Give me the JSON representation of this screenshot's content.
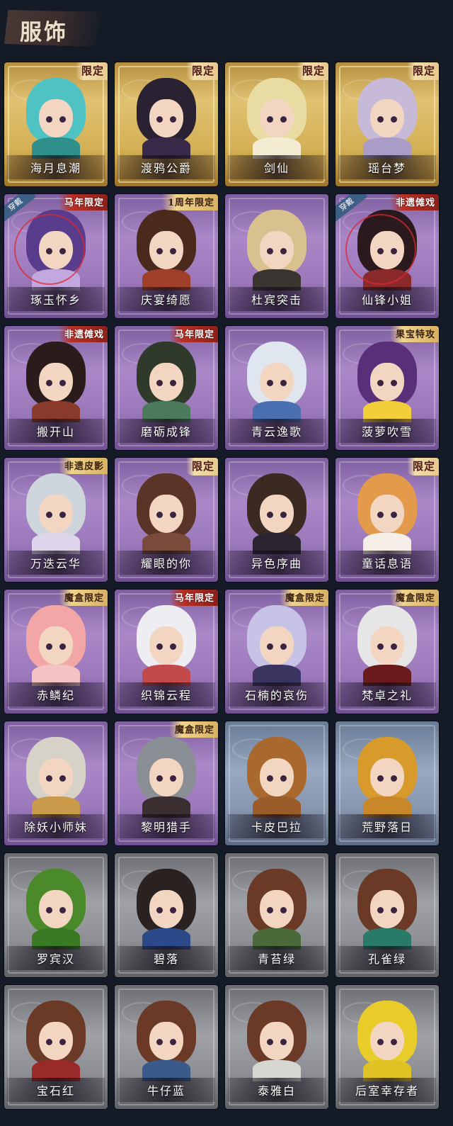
{
  "header": {
    "title": "服饰"
  },
  "outfits": [
    {
      "name": "海月息潮",
      "tag": "限定",
      "tag_style": "light",
      "rarity": "gold",
      "worn": false,
      "hair": "#4fc2c4",
      "body": "#2f8f8a"
    },
    {
      "name": "渡鸦公爵",
      "tag": "限定",
      "tag_style": "light",
      "rarity": "gold",
      "worn": false,
      "hair": "#2a2233",
      "body": "#3a2a4a"
    },
    {
      "name": "剑仙",
      "tag": "限定",
      "tag_style": "light",
      "rarity": "gold",
      "worn": false,
      "hair": "#e8dca2",
      "body": "#f4ecd2"
    },
    {
      "name": "瑶台梦",
      "tag": "限定",
      "tag_style": "light",
      "rarity": "gold",
      "worn": false,
      "hair": "#c7b9d8",
      "body": "#a99cc7"
    },
    {
      "name": "琢玉怀乡",
      "tag": "马年限定",
      "tag_style": "red",
      "rarity": "purple",
      "worn": true,
      "worn_label": "穿戴",
      "hair": "#5a3c8c",
      "body": "#c3a8e0"
    },
    {
      "name": "庆宴绮愿",
      "tag": "1周年限定",
      "tag_style": "dark",
      "rarity": "purple",
      "worn": false,
      "hair": "#4a2a1c",
      "body": "#a0402a"
    },
    {
      "name": "杜宾突击",
      "tag": "",
      "tag_style": "light",
      "rarity": "purple",
      "worn": false,
      "hair": "#d8c18e",
      "body": "#3a3530"
    },
    {
      "name": "仙锋小姐",
      "tag": "非遗傩戏",
      "tag_style": "red",
      "rarity": "purple",
      "worn": true,
      "worn_label": "穿戴",
      "hair": "#2a1a1e",
      "body": "#8a2a2a"
    },
    {
      "name": "搬开山",
      "tag": "非遗傩戏",
      "tag_style": "red",
      "rarity": "purple",
      "worn": false,
      "hair": "#2a1c1a",
      "body": "#8a3a2a"
    },
    {
      "name": "磨砺成锋",
      "tag": "马年限定",
      "tag_style": "red",
      "rarity": "purple",
      "worn": false,
      "hair": "#2f3a2a",
      "body": "#4a7a5a"
    },
    {
      "name": "青云逸歌",
      "tag": "",
      "tag_style": "light",
      "rarity": "purple",
      "worn": false,
      "hair": "#dfe6f0",
      "body": "#4a6fb0"
    },
    {
      "name": "菠萝吹雪",
      "tag": "果宝特攻",
      "tag_style": "dark",
      "rarity": "purple",
      "worn": false,
      "hair": "#5a2f7a",
      "body": "#f2cf3a"
    },
    {
      "name": "万迭云华",
      "tag": "非遗皮影",
      "tag_style": "dark",
      "rarity": "purple",
      "worn": false,
      "hair": "#cfd5dc",
      "body": "#ddd6ea"
    },
    {
      "name": "耀眼的你",
      "tag": "限定",
      "tag_style": "light",
      "rarity": "purple",
      "worn": false,
      "hair": "#5a3426",
      "body": "#7a4a3a"
    },
    {
      "name": "异色序曲",
      "tag": "",
      "tag_style": "light",
      "rarity": "purple",
      "worn": false,
      "hair": "#3a2a22",
      "body": "#2a2530"
    },
    {
      "name": "童话息语",
      "tag": "限定",
      "tag_style": "light",
      "rarity": "purple",
      "worn": false,
      "hair": "#e39a4a",
      "body": "#f4eee6"
    },
    {
      "name": "赤鳞纪",
      "tag": "魔盒限定",
      "tag_style": "dark",
      "rarity": "purple",
      "worn": false,
      "hair": "#f2a6a6",
      "body": "#f4c2c2"
    },
    {
      "name": "织锦云程",
      "tag": "马年限定",
      "tag_style": "red",
      "rarity": "purple",
      "worn": false,
      "hair": "#eeeef2",
      "body": "#c24a4a"
    },
    {
      "name": "石楠的哀伤",
      "tag": "魔盒限定",
      "tag_style": "dark",
      "rarity": "purple",
      "worn": false,
      "hair": "#c6c3e6",
      "body": "#3a3560"
    },
    {
      "name": "梵卓之礼",
      "tag": "魔盒限定",
      "tag_style": "dark",
      "rarity": "purple",
      "worn": false,
      "hair": "#e6e6e6",
      "body": "#6a1a1a"
    },
    {
      "name": "除妖小师妹",
      "tag": "",
      "tag_style": "light",
      "rarity": "purple",
      "worn": false,
      "hair": "#d6d2c8",
      "body": "#c99a4a"
    },
    {
      "name": "黎明猎手",
      "tag": "魔盒限定",
      "tag_style": "dark",
      "rarity": "purple",
      "worn": false,
      "hair": "#8a8f96",
      "body": "#3a2e30"
    },
    {
      "name": "卡皮巴拉",
      "tag": "",
      "tag_style": "light",
      "rarity": "blue",
      "worn": false,
      "hair": "#a8682e",
      "body": "#9a5c28"
    },
    {
      "name": "荒野落日",
      "tag": "",
      "tag_style": "light",
      "rarity": "blue",
      "worn": false,
      "hair": "#d89a2a",
      "body": "#c8882a"
    },
    {
      "name": "罗宾汉",
      "tag": "",
      "tag_style": "light",
      "rarity": "gray",
      "worn": false,
      "hair": "#4a8a2a",
      "body": "#3a7a24"
    },
    {
      "name": "碧落",
      "tag": "",
      "tag_style": "light",
      "rarity": "gray",
      "worn": false,
      "hair": "#2a2220",
      "body": "#2c4a8a"
    },
    {
      "name": "青苔绿",
      "tag": "",
      "tag_style": "light",
      "rarity": "gray",
      "worn": false,
      "hair": "#6a3a26",
      "body": "#4a6a3a"
    },
    {
      "name": "孔雀绿",
      "tag": "",
      "tag_style": "light",
      "rarity": "gray",
      "worn": false,
      "hair": "#6a3a26",
      "body": "#2a7a6a"
    },
    {
      "name": "宝石红",
      "tag": "",
      "tag_style": "light",
      "rarity": "gray",
      "worn": false,
      "hair": "#6a3a26",
      "body": "#9a2a2a"
    },
    {
      "name": "牛仔蓝",
      "tag": "",
      "tag_style": "light",
      "rarity": "gray",
      "worn": false,
      "hair": "#6a3a26",
      "body": "#3a5a8a"
    },
    {
      "name": "泰雅白",
      "tag": "",
      "tag_style": "light",
      "rarity": "gray",
      "worn": false,
      "hair": "#6a3a26",
      "body": "#d6d6d2"
    },
    {
      "name": "后室幸存者",
      "tag": "",
      "tag_style": "light",
      "rarity": "gray",
      "worn": false,
      "hair": "#e8cc2a",
      "body": "#e0c224"
    }
  ]
}
